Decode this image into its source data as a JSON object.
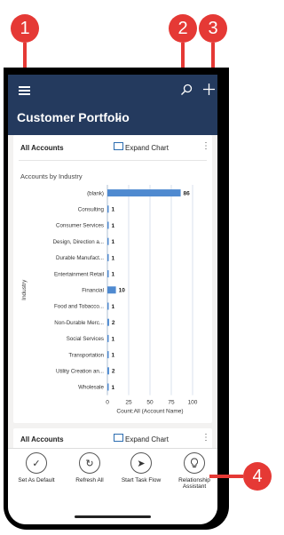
{
  "callouts": [
    "1",
    "2",
    "3",
    "4"
  ],
  "header": {
    "title": "Customer Portfolio",
    "menu_icon": "hamburger-icon",
    "search_icon": "search-icon",
    "add_icon": "plus-icon"
  },
  "card1": {
    "title": "All Accounts",
    "expand_label": "Expand Chart",
    "chart_title": "Accounts by Industry"
  },
  "card2": {
    "title": "All Accounts",
    "expand_label": "Expand Chart"
  },
  "chart_data": {
    "type": "bar",
    "orientation": "horizontal",
    "title": "Accounts by Industry",
    "xlabel": "Count:All (Account Name)",
    "ylabel": "Industry",
    "categories": [
      "(blank)",
      "Consulting",
      "Consumer Services",
      "Design, Direction a...",
      "Durable Manufact...",
      "Entertainment Retail",
      "Financial",
      "Food and Tobacco...",
      "Non-Durable Merc...",
      "Social Services",
      "Transportation",
      "Utility Creation an...",
      "Wholesale"
    ],
    "values": [
      86,
      1,
      1,
      1,
      1,
      1,
      10,
      1,
      2,
      1,
      1,
      2,
      1
    ],
    "xlim": [
      0,
      100
    ],
    "xticks": [
      "0",
      "25",
      "50",
      "75",
      "100"
    ],
    "color": "#4f8ad0"
  },
  "footer": {
    "buttons": [
      {
        "label": "Set As Default",
        "icon": "check-icon"
      },
      {
        "label": "Refresh All",
        "icon": "refresh-icon"
      },
      {
        "label": "Start Task Flow",
        "icon": "task-flow-icon"
      },
      {
        "label": "Relationship Assistant",
        "icon": "lightbulb-icon"
      }
    ]
  }
}
